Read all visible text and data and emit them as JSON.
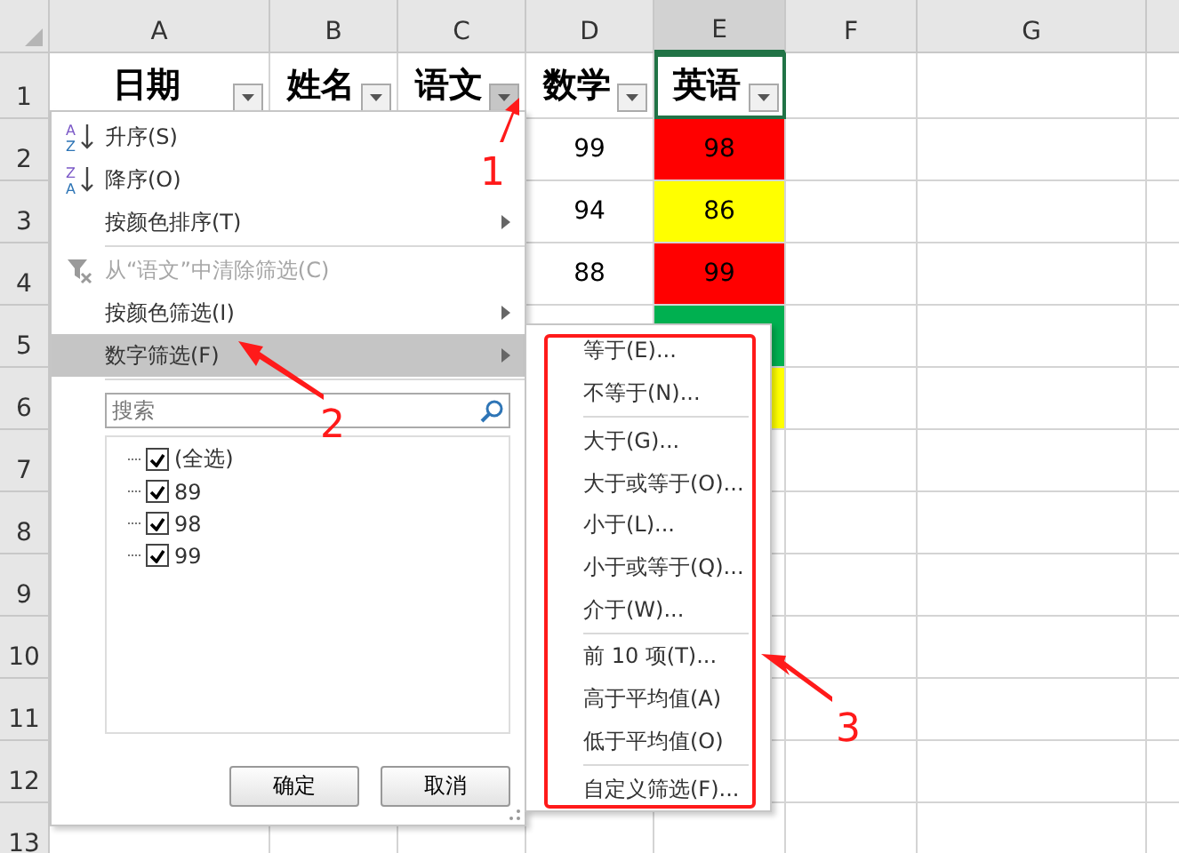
{
  "columns": [
    {
      "letter": "A",
      "selected": false
    },
    {
      "letter": "B",
      "selected": false
    },
    {
      "letter": "C",
      "selected": false
    },
    {
      "letter": "D",
      "selected": false
    },
    {
      "letter": "E",
      "selected": true
    },
    {
      "letter": "F",
      "selected": false
    },
    {
      "letter": "G",
      "selected": false
    }
  ],
  "header_row": {
    "number": "1",
    "cells": [
      {
        "text": "日期",
        "pressed": false,
        "selected": false
      },
      {
        "text": "姓名",
        "pressed": false,
        "selected": false
      },
      {
        "text": "语文",
        "pressed": true,
        "selected": false
      },
      {
        "text": "数学",
        "pressed": false,
        "selected": false
      },
      {
        "text": "英语",
        "pressed": false,
        "selected": true
      }
    ]
  },
  "rows": [
    {
      "number": "2",
      "math": "99",
      "english": {
        "text": "98",
        "color": "#ff0000"
      }
    },
    {
      "number": "3",
      "math": "94",
      "english": {
        "text": "86",
        "color": "#ffff00"
      }
    },
    {
      "number": "4",
      "math": "88",
      "english": {
        "text": "99",
        "color": "#ff0000"
      }
    },
    {
      "number": "5",
      "english": {
        "color": "#00b050"
      }
    },
    {
      "number": "6",
      "english": {
        "color": "#ffff00"
      }
    },
    {
      "number": "7"
    },
    {
      "number": "8"
    },
    {
      "number": "9"
    },
    {
      "number": "10"
    },
    {
      "number": "11"
    },
    {
      "number": "12"
    },
    {
      "number": "13"
    }
  ],
  "filter_menu": {
    "items": [
      {
        "kind": "sort",
        "label": "升序(S)",
        "icon_top": "A",
        "icon_bottom": "Z",
        "submenu": false,
        "disabled": false,
        "highlighted": false
      },
      {
        "kind": "sort",
        "label": "降序(O)",
        "icon_top": "Z",
        "icon_bottom": "A",
        "submenu": false,
        "disabled": false,
        "highlighted": false
      },
      {
        "kind": "plain",
        "label": "按颜色排序(T)",
        "submenu": true,
        "disabled": false,
        "highlighted": false
      },
      {
        "kind": "separator"
      },
      {
        "kind": "clear",
        "label": "从“语文”中清除筛选(C)",
        "submenu": false,
        "disabled": true,
        "highlighted": false
      },
      {
        "kind": "plain",
        "label": "按颜色筛选(I)",
        "submenu": true,
        "disabled": false,
        "highlighted": false
      },
      {
        "kind": "plain",
        "label": "数字筛选(F)",
        "submenu": true,
        "disabled": false,
        "highlighted": true
      }
    ],
    "search": {
      "placeholder": "搜索"
    },
    "values": [
      {
        "label": "(全选)",
        "checked": true
      },
      {
        "label": "89",
        "checked": true
      },
      {
        "label": "98",
        "checked": true
      },
      {
        "label": "99",
        "checked": true
      }
    ],
    "buttons": [
      "确定",
      "取消"
    ]
  },
  "number_filter_menu": {
    "groups": [
      [
        "等于(E)...",
        "不等于(N)..."
      ],
      [
        "大于(G)...",
        "大于或等于(O)...",
        "小于(L)...",
        "小于或等于(Q)...",
        "介于(W)..."
      ],
      [
        "前 10 项(T)...",
        "高于平均值(A)",
        "低于平均值(O)"
      ],
      [
        "自定义筛选(F)..."
      ]
    ]
  },
  "annotations": [
    "1",
    "2",
    "3"
  ]
}
